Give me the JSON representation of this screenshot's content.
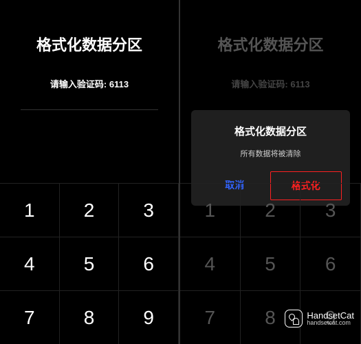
{
  "left": {
    "title": "格式化数据分区",
    "subtitle": "请输入验证码: 6113",
    "keys": [
      "1",
      "2",
      "3",
      "4",
      "5",
      "6",
      "7",
      "8",
      "9"
    ]
  },
  "right": {
    "title": "格式化数据分区",
    "subtitle": "请输入验证码: 6113",
    "keys": [
      "1",
      "2",
      "3",
      "4",
      "5",
      "6",
      "7",
      "8",
      "9"
    ],
    "dialog": {
      "title": "格式化数据分区",
      "message": "所有数据将被清除",
      "cancel": "取消",
      "confirm": "格式化"
    }
  },
  "watermark": {
    "line1": "HandsetCat",
    "line2": "handsetcat.com"
  }
}
